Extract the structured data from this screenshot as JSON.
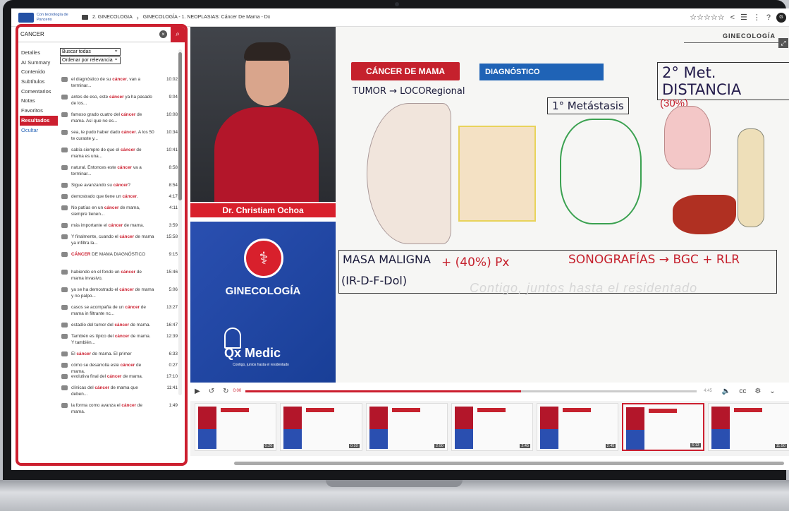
{
  "topbar": {
    "logo_text": "Con tecnología de Pancerio",
    "breadcrumb_course": "2. GINECOLOGIA",
    "breadcrumb_lesson": "GINECOLOGÍA - 1. NEOPLASIAS: Cáncer De Mama - Dx",
    "stars": "☆☆☆☆☆",
    "avatar": "G"
  },
  "panel": {
    "search_value": "CANCER",
    "side_items": [
      {
        "label": "Detalles"
      },
      {
        "label": "AI Summary"
      },
      {
        "label": "Contenido"
      },
      {
        "label": "Subtítulos"
      },
      {
        "label": "Comentarios"
      },
      {
        "label": "Notas"
      },
      {
        "label": "Favoritos"
      },
      {
        "label": "Resultados"
      },
      {
        "label": "Ocultar"
      }
    ],
    "filter_scope": "Buscar todas",
    "filter_order": "Ordenar por relevancia",
    "results": [
      {
        "pre": "el diagnóstico de su ",
        "hl": "cáncer",
        "post": ", van a terminar...",
        "time": "10:02"
      },
      {
        "pre": "antes de eso, este ",
        "hl": "cáncer",
        "post": " ya ha pasado de los...",
        "time": "9:04"
      },
      {
        "pre": "famoso grado cuatro del ",
        "hl": "cáncer",
        "post": " de mama. Así que no es...",
        "time": "10:08"
      },
      {
        "pre": "sea, te pudo haber dado ",
        "hl": "cáncer",
        "post": ". A los 50 te curaste y...",
        "time": "10:34"
      },
      {
        "pre": "sabía siempre de que el ",
        "hl": "cáncer",
        "post": " de mama es una...",
        "time": "10:41"
      },
      {
        "pre": "natural. Entonces este ",
        "hl": "cáncer",
        "post": " va a terminar...",
        "time": "8:58"
      },
      {
        "pre": "Sigue avanzando su ",
        "hl": "cáncer",
        "post": "?",
        "time": "8:54"
      },
      {
        "pre": "demostrado que tiene un ",
        "hl": "cáncer",
        "post": ".",
        "time": "4:17"
      },
      {
        "pre": "No patías en un ",
        "hl": "cáncer",
        "post": " de mama, siempre tienen...",
        "time": "4:11"
      },
      {
        "pre": "más importante el ",
        "hl": "cáncer",
        "post": " de mama.",
        "time": "3:59"
      },
      {
        "pre": "Y finalmente, cuando el ",
        "hl": "cáncer",
        "post": " de mama ya infiltra la...",
        "time": "15:58"
      },
      {
        "pre": "",
        "hl": "CÁNCER",
        "post": " DE MAMA DIAGNÓSTICO",
        "time": "9:15"
      },
      {
        "pre": "habiendo en el fondo un ",
        "hl": "cáncer",
        "post": " de mama invasivo,",
        "time": "15:46"
      },
      {
        "pre": "ya se ha demostrado el ",
        "hl": "cáncer",
        "post": " de mama y no palpo...",
        "time": "5:06"
      },
      {
        "pre": "casos se acompaña de un ",
        "hl": "cáncer",
        "post": " de mama in filtrante nc...",
        "time": "13:27"
      },
      {
        "pre": "estadío del tumor del ",
        "hl": "cáncer",
        "post": " de mama.",
        "time": "16:47"
      },
      {
        "pre": "También es típico del ",
        "hl": "cáncer",
        "post": " de mama. Y también...",
        "time": "12:39"
      },
      {
        "pre": "El ",
        "hl": "cáncer",
        "post": " de mama. El primer",
        "time": "6:33"
      },
      {
        "pre": "cómo se desarrolla este ",
        "hl": "cáncer",
        "post": " de mama.",
        "time": "0:27"
      },
      {
        "pre": "evolutiva final del ",
        "hl": "cáncer",
        "post": " de mama.",
        "time": "17:10"
      },
      {
        "pre": "clínicas del ",
        "hl": "cáncer",
        "post": " de mama que deben...",
        "time": "11:41"
      },
      {
        "pre": "la forma como avanza el ",
        "hl": "cáncer",
        "post": " de mama.",
        "time": "1:49"
      }
    ]
  },
  "video": {
    "presenter_name": "Dr. Christiam Ochoa",
    "brand_title": "GINECOLOGÍA",
    "brand_logo": "Qx Medic",
    "brand_tagline": "Contigo, juntos hasta el residentado",
    "board_label": "GINECOLOGÍA",
    "slide_title": "CÁNCER DE MAMA",
    "slide_tag": "DIAGNÓSTICO",
    "hw_tumor": "TUMOR → LOCORegional",
    "hw_met_distancia": "2° Met. DISTANCIA",
    "hw_metastasis": "1° Metástasis",
    "hw_pct30": "(30%)",
    "hw_masa": "MASA MALIGNA",
    "hw_sono": "+ (40%) Px",
    "hw_ecografia": "SONOGRAFÍAS → BGC + RLR",
    "hw_ir": "(IR-D-F-Dol)",
    "watermark": "Contigo, juntos hasta el residentado"
  },
  "player": {
    "current_time": "0:00",
    "total_time": "4:45",
    "progress": 0.61,
    "thumb_durations": [
      "0:20",
      "0:10",
      "2:00",
      "2:45",
      "2:45",
      "6:13",
      "11:50"
    ]
  },
  "colors": {
    "accent": "#cc1f2f",
    "brand_blue": "#1f63b6"
  }
}
